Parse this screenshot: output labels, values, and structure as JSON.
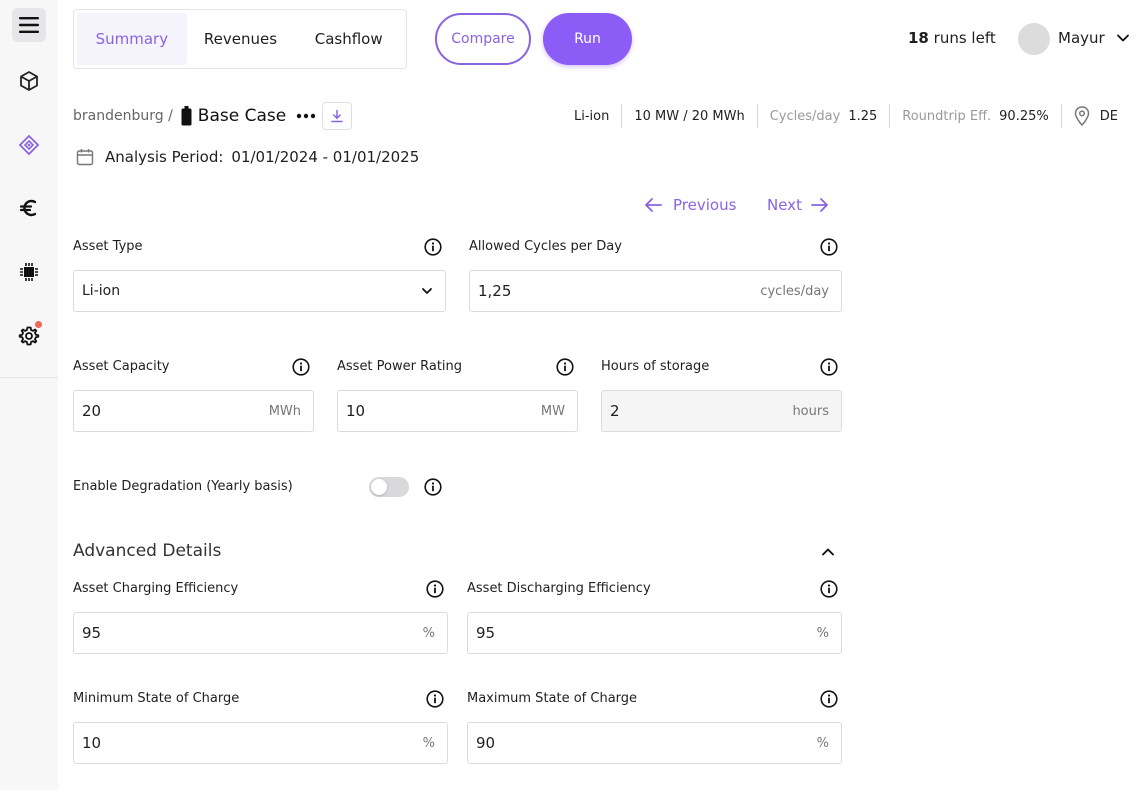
{
  "sidebar": {
    "items": [
      {
        "icon": "menu-icon"
      },
      {
        "icon": "cube-icon"
      },
      {
        "icon": "asset-diamond-icon"
      },
      {
        "icon": "euro-icon"
      },
      {
        "icon": "chip-icon"
      },
      {
        "icon": "gear-icon"
      }
    ]
  },
  "tabs": [
    {
      "label": "Summary",
      "active": true
    },
    {
      "label": "Revenues"
    },
    {
      "label": "Cashflow"
    }
  ],
  "actions": {
    "compare": "Compare",
    "run": "Run"
  },
  "runs": {
    "count": "18",
    "suffix": "runs left"
  },
  "user": {
    "name": "Mayur"
  },
  "breadcrumb": {
    "parent": "brandenburg /",
    "name": "Base Case"
  },
  "specs": {
    "type": "Li-ion",
    "power_capacity": "10 MW / 20 MWh",
    "cycles_label": "Cycles/day",
    "cycles_value": "1.25",
    "rte_label": "Roundtrip Eff.",
    "rte_value": "90.25%",
    "country": "DE"
  },
  "period": {
    "label": "Analysis Period:",
    "value": "01/01/2024 - 01/01/2025"
  },
  "nav": {
    "previous": "Previous",
    "next": "Next"
  },
  "form": {
    "asset_type": {
      "label": "Asset Type",
      "value": "Li-ion"
    },
    "cycles": {
      "label": "Allowed Cycles per Day",
      "value": "1,25",
      "unit": "cycles/day"
    },
    "capacity": {
      "label": "Asset Capacity",
      "value": "20",
      "unit": "MWh"
    },
    "power": {
      "label": "Asset Power Rating",
      "value": "10",
      "unit": "MW"
    },
    "hours": {
      "label": "Hours of storage",
      "value": "2",
      "unit": "hours"
    },
    "degradation": {
      "label": "Enable Degradation (Yearly basis)",
      "enabled": false
    }
  },
  "advanced": {
    "title": "Advanced Details",
    "charging": {
      "label": "Asset Charging Efficiency",
      "value": "95",
      "unit": "%"
    },
    "discharging": {
      "label": "Asset Discharging Efficiency",
      "value": "95",
      "unit": "%"
    },
    "min_soc": {
      "label": "Minimum State of Charge",
      "value": "10",
      "unit": "%"
    },
    "max_soc": {
      "label": "Maximum State of Charge",
      "value": "90",
      "unit": "%"
    }
  },
  "colors": {
    "accent": "#8b5cf6",
    "accent_text": "#8a63e0",
    "notification": "#f0685a"
  }
}
